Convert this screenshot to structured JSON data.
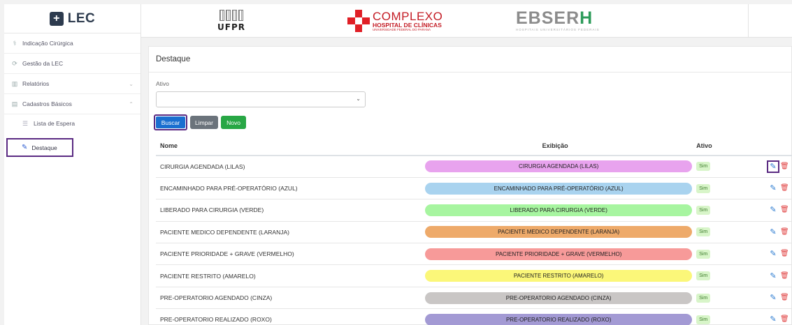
{
  "app": {
    "logo_text": "LEC"
  },
  "sidebar": {
    "items": [
      {
        "label": "Indicação Cirúrgica",
        "icon": "stethoscope-icon"
      },
      {
        "label": "Gestão da LEC",
        "icon": "refresh-icon"
      },
      {
        "label": "Relatórios",
        "icon": "chart-icon"
      },
      {
        "label": "Cadastros Básicos",
        "icon": "database-icon"
      }
    ],
    "sub_items": [
      {
        "label": "Lista de Espera",
        "icon": "list-icon"
      }
    ],
    "active": {
      "label": "Destaque",
      "icon": "pencil-icon"
    }
  },
  "header": {
    "ufpr": "UFPR",
    "complexo_title": "COMPLEXO",
    "complexo_sub": "HOSPITAL DE CLÍNICAS",
    "complexo_small": "UNIVERSIDADE FEDERAL DO PARANÁ",
    "ebserh_pre": "EBSER",
    "ebserh_h": "H",
    "ebserh_sub": "HOSPITAIS UNIVERSITÁRIOS FEDERAIS"
  },
  "page": {
    "title": "Destaque",
    "filter_label": "Ativo",
    "select_value": "",
    "buttons": {
      "buscar": "Buscar",
      "limpar": "Limpar",
      "novo": "Novo"
    }
  },
  "table": {
    "headers": {
      "nome": "Nome",
      "exibicao": "Exibição",
      "ativo": "Ativo"
    },
    "rows": [
      {
        "nome": "CIRURGIA AGENDADA (LILAS)",
        "exibicao": "CIRURGIA AGENDADA (LILAS)",
        "color": "#e8a3ee",
        "ativo": "Sim"
      },
      {
        "nome": "ENCAMINHADO PARA PRÉ-OPERATÓRIO (AZUL)",
        "exibicao": "ENCAMINHADO PARA PRÉ-OPERATÓRIO (AZUL)",
        "color": "#a9d3ef",
        "ativo": "Sim"
      },
      {
        "nome": "LIBERADO PARA CIRURGIA (VERDE)",
        "exibicao": "LIBERADO PARA CIRURGIA (VERDE)",
        "color": "#a7f5a0",
        "ativo": "Sim"
      },
      {
        "nome": "PACIENTE MEDICO DEPENDENTE (LARANJA)",
        "exibicao": "PACIENTE MEDICO DEPENDENTE (LARANJA)",
        "color": "#eeaa6a",
        "ativo": "Sim"
      },
      {
        "nome": "PACIENTE PRIORIDADE + GRAVE (VERMELHO)",
        "exibicao": "PACIENTE PRIORIDADE + GRAVE (VERMELHO)",
        "color": "#f79a99",
        "ativo": "Sim"
      },
      {
        "nome": "PACIENTE RESTRITO (AMARELO)",
        "exibicao": "PACIENTE RESTRITO (AMARELO)",
        "color": "#fbf779",
        "ativo": "Sim"
      },
      {
        "nome": "PRE-OPERATORIO AGENDADO (CINZA)",
        "exibicao": "PRE-OPERATORIO AGENDADO (CINZA)",
        "color": "#c9c6c5",
        "ativo": "Sim"
      },
      {
        "nome": "PRE-OPERATORIO REALIZADO (ROXO)",
        "exibicao": "PRE-OPERATORIO REALIZADO (ROXO)",
        "color": "#a39ad4",
        "ativo": "Sim"
      }
    ]
  }
}
